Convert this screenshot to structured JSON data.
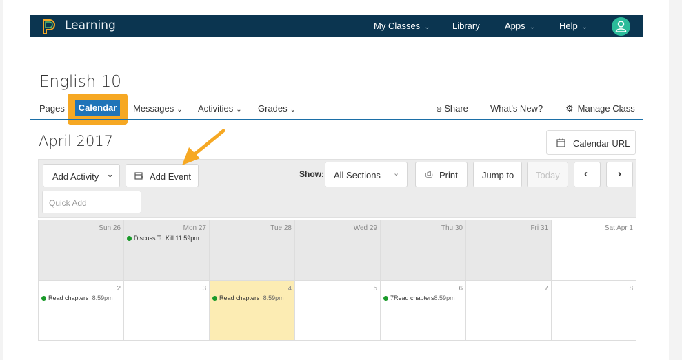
{
  "topbar": {
    "brand": "Learning",
    "nav": [
      {
        "label": "My Classes",
        "has_menu": true
      },
      {
        "label": "Library",
        "has_menu": false
      },
      {
        "label": "Apps",
        "has_menu": true
      },
      {
        "label": "Help",
        "has_menu": true
      }
    ],
    "brand_color": "#0b3550",
    "avatar_color": "#2bbb9a"
  },
  "course": {
    "title": "English 10"
  },
  "tabs": {
    "pages": "Pages",
    "calendar": "Calendar",
    "messages": "Messages",
    "activities": "Activities",
    "grades": "Grades",
    "active": "Calendar"
  },
  "actions": {
    "share": "Share",
    "whats_new": "What's New?",
    "manage_class": "Manage Class"
  },
  "calendar": {
    "month": "April 2017",
    "calendar_url": "Calendar URL",
    "toolbar": {
      "add_activity": "Add Activity",
      "add_event": "Add Event",
      "show_label": "Show:",
      "sections_value": "All Sections",
      "print": "Print",
      "jump_to": "Jump to",
      "today": "Today",
      "quick_add_placeholder": "Quick Add"
    },
    "weeks": [
      {
        "days": [
          {
            "label": "Sun 26",
            "style": "grey",
            "events": []
          },
          {
            "label": "Mon 27",
            "style": "grey",
            "events": [
              {
                "title": "Discuss To Kill 11:59pm",
                "time": ""
              }
            ]
          },
          {
            "label": "Tue 28",
            "style": "grey",
            "events": []
          },
          {
            "label": "Wed 29",
            "style": "grey",
            "events": []
          },
          {
            "label": "Thu 30",
            "style": "grey",
            "events": []
          },
          {
            "label": "Fri 31",
            "style": "grey",
            "events": []
          },
          {
            "label": "Sat Apr 1",
            "style": "white",
            "events": []
          }
        ]
      },
      {
        "days": [
          {
            "label": "2",
            "style": "white",
            "events": [
              {
                "title": "Read chapters",
                "time": "8:59pm"
              }
            ]
          },
          {
            "label": "3",
            "style": "white",
            "events": []
          },
          {
            "label": "4",
            "style": "today",
            "events": [
              {
                "title": "Read chapters",
                "time": "8:59pm"
              }
            ]
          },
          {
            "label": "5",
            "style": "white",
            "events": []
          },
          {
            "label": "6",
            "style": "white",
            "events": [
              {
                "title": "7Read chapters",
                "time": "8:59pm"
              }
            ]
          },
          {
            "label": "7",
            "style": "white",
            "events": []
          },
          {
            "label": "8",
            "style": "white",
            "events": []
          }
        ]
      }
    ],
    "event_dot_color": "#1a9a2a",
    "today_color": "#fcecb3"
  },
  "annotation": {
    "highlight_color": "#f6a823",
    "arrow_color": "#f6a823"
  }
}
